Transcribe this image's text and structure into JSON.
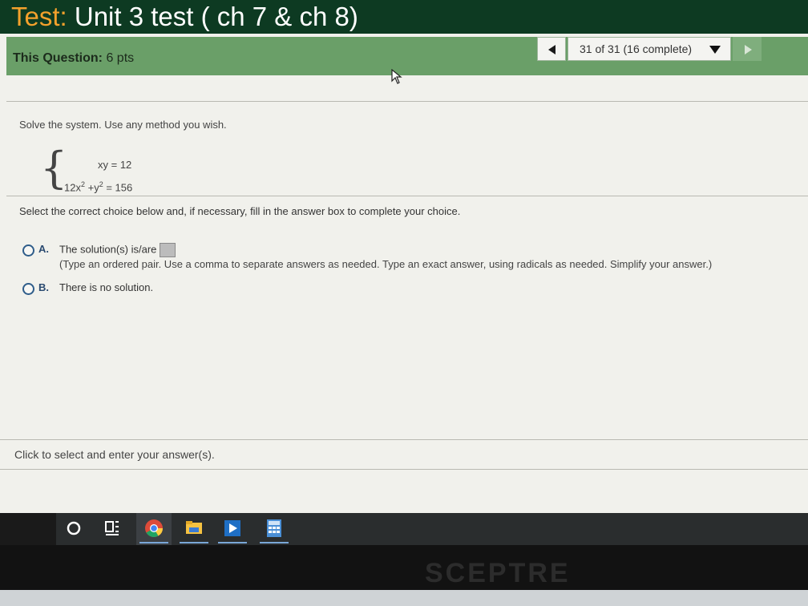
{
  "header": {
    "title_prefix": "Test:",
    "title_rest": " Unit 3 test ( ch 7 & ch 8)"
  },
  "question_bar": {
    "label": "This Question:",
    "points": " 6 pts",
    "nav_status": "31 of 31 (16 complete)"
  },
  "question": {
    "instruction": "Solve the system.  Use any method you wish.",
    "eq1": "xy = 12",
    "eq2_part1": "12x",
    "eq2_part2": "+y",
    "eq2_part3": "= 156",
    "exp": "2",
    "select_prompt": "Select the correct choice below and, if necessary, fill in the answer box to complete your choice."
  },
  "choices": [
    {
      "letter": "A.",
      "text": "The solution(s) is/are"
    },
    {
      "letter": "B.",
      "text": "There is no solution."
    }
  ],
  "hint": "(Type an ordered pair. Use a comma to separate answers as needed. Type an exact answer, using radicals as needed. Simplify your answer.)",
  "footer_note": "Click to select and enter your answer(s).",
  "monitor": {
    "brand": "SCEPTRE"
  },
  "colors": {
    "title_bar": "#0d3a22",
    "title_prefix": "#f3a12c",
    "question_bar": "#6a9f68",
    "radio": "#2f5d8a"
  },
  "taskbar_icons": [
    "cortana-circle-icon",
    "task-view-icon",
    "chrome-icon",
    "file-explorer-icon",
    "media-player-icon",
    "calculator-icon"
  ]
}
